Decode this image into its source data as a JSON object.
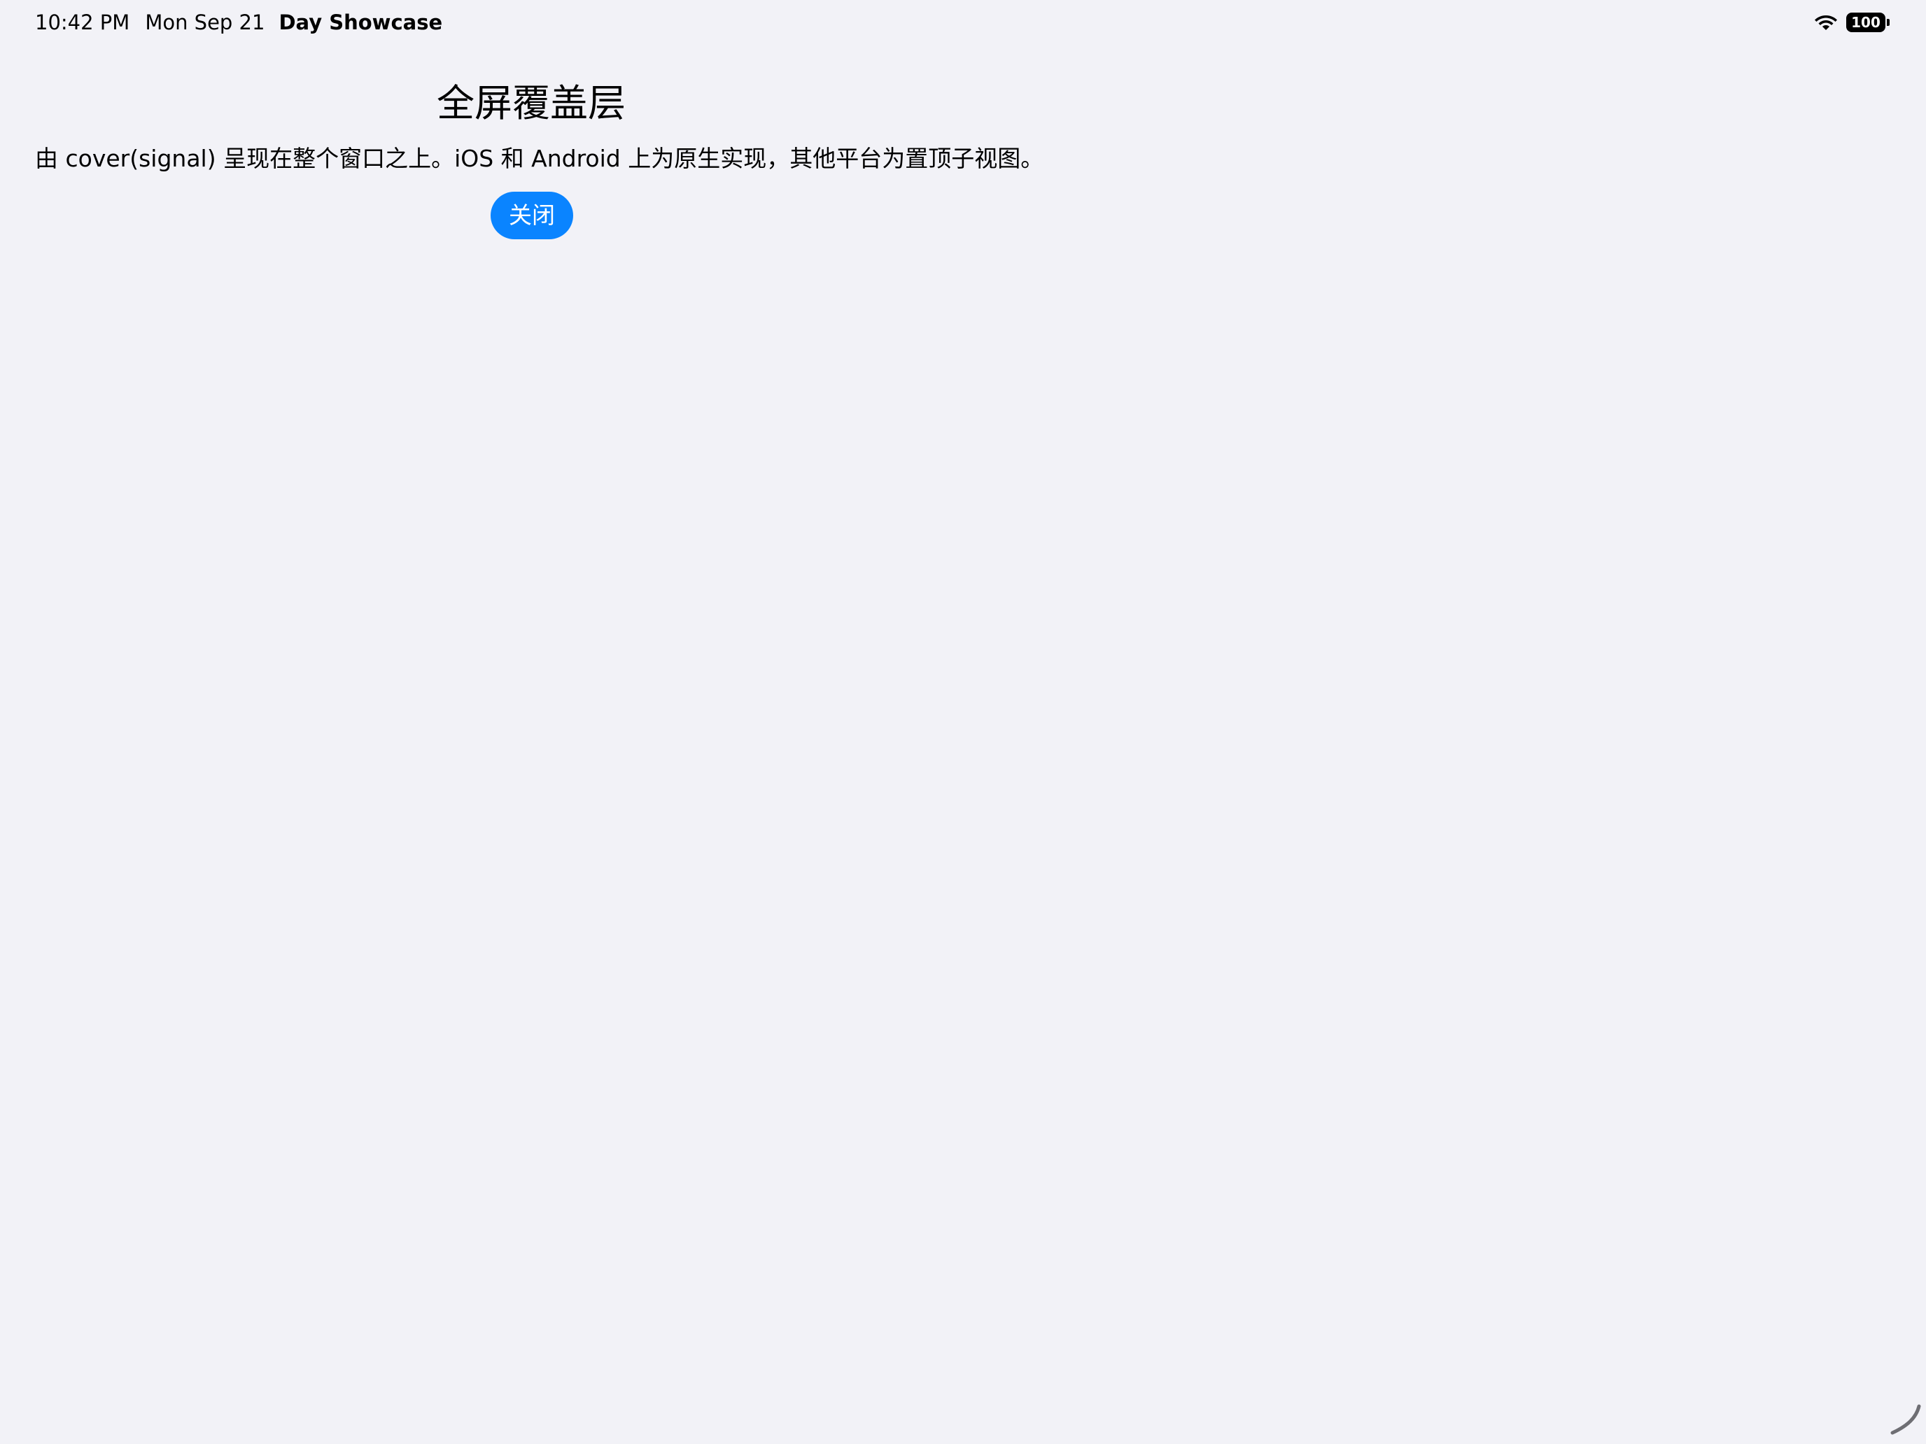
{
  "status_bar": {
    "time": "10:42 PM",
    "date": "Mon Sep 21",
    "app_name": "Day Showcase",
    "battery_level": "100",
    "wifi_icon": "wifi-icon",
    "battery_icon": "battery-icon"
  },
  "cover": {
    "title": "全屏覆盖层",
    "description": "由 cover(signal) 呈现在整个窗口之上。iOS 和 Android 上为原生实现，其他平台为置顶子视图。",
    "close_label": "关闭"
  },
  "colors": {
    "background": "#f2f2f7",
    "accent": "#0a84ff",
    "text": "#000000"
  }
}
